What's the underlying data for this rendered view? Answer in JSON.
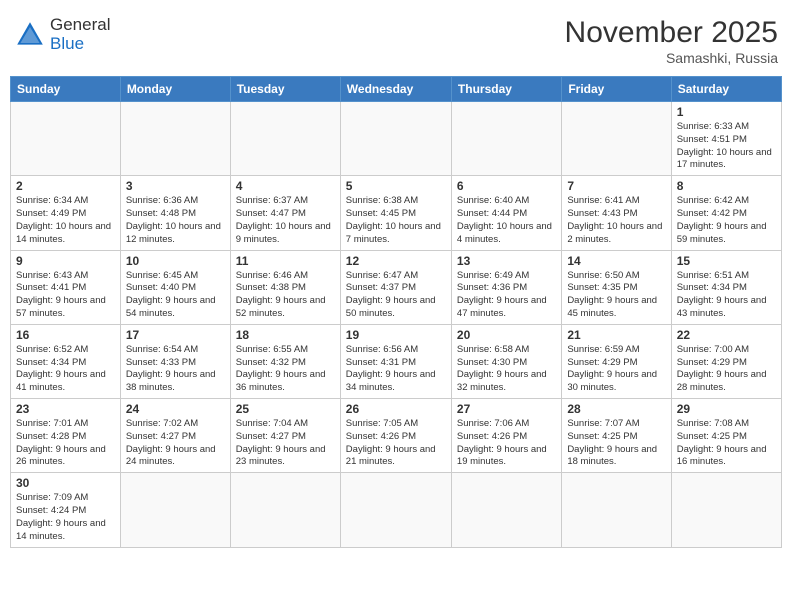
{
  "header": {
    "logo_general": "General",
    "logo_blue": "Blue",
    "month_year": "November 2025",
    "location": "Samashki, Russia"
  },
  "weekdays": [
    "Sunday",
    "Monday",
    "Tuesday",
    "Wednesday",
    "Thursday",
    "Friday",
    "Saturday"
  ],
  "weeks": [
    [
      {
        "day": "",
        "info": ""
      },
      {
        "day": "",
        "info": ""
      },
      {
        "day": "",
        "info": ""
      },
      {
        "day": "",
        "info": ""
      },
      {
        "day": "",
        "info": ""
      },
      {
        "day": "",
        "info": ""
      },
      {
        "day": "1",
        "info": "Sunrise: 6:33 AM\nSunset: 4:51 PM\nDaylight: 10 hours and 17 minutes."
      }
    ],
    [
      {
        "day": "2",
        "info": "Sunrise: 6:34 AM\nSunset: 4:49 PM\nDaylight: 10 hours and 14 minutes."
      },
      {
        "day": "3",
        "info": "Sunrise: 6:36 AM\nSunset: 4:48 PM\nDaylight: 10 hours and 12 minutes."
      },
      {
        "day": "4",
        "info": "Sunrise: 6:37 AM\nSunset: 4:47 PM\nDaylight: 10 hours and 9 minutes."
      },
      {
        "day": "5",
        "info": "Sunrise: 6:38 AM\nSunset: 4:45 PM\nDaylight: 10 hours and 7 minutes."
      },
      {
        "day": "6",
        "info": "Sunrise: 6:40 AM\nSunset: 4:44 PM\nDaylight: 10 hours and 4 minutes."
      },
      {
        "day": "7",
        "info": "Sunrise: 6:41 AM\nSunset: 4:43 PM\nDaylight: 10 hours and 2 minutes."
      },
      {
        "day": "8",
        "info": "Sunrise: 6:42 AM\nSunset: 4:42 PM\nDaylight: 9 hours and 59 minutes."
      }
    ],
    [
      {
        "day": "9",
        "info": "Sunrise: 6:43 AM\nSunset: 4:41 PM\nDaylight: 9 hours and 57 minutes."
      },
      {
        "day": "10",
        "info": "Sunrise: 6:45 AM\nSunset: 4:40 PM\nDaylight: 9 hours and 54 minutes."
      },
      {
        "day": "11",
        "info": "Sunrise: 6:46 AM\nSunset: 4:38 PM\nDaylight: 9 hours and 52 minutes."
      },
      {
        "day": "12",
        "info": "Sunrise: 6:47 AM\nSunset: 4:37 PM\nDaylight: 9 hours and 50 minutes."
      },
      {
        "day": "13",
        "info": "Sunrise: 6:49 AM\nSunset: 4:36 PM\nDaylight: 9 hours and 47 minutes."
      },
      {
        "day": "14",
        "info": "Sunrise: 6:50 AM\nSunset: 4:35 PM\nDaylight: 9 hours and 45 minutes."
      },
      {
        "day": "15",
        "info": "Sunrise: 6:51 AM\nSunset: 4:34 PM\nDaylight: 9 hours and 43 minutes."
      }
    ],
    [
      {
        "day": "16",
        "info": "Sunrise: 6:52 AM\nSunset: 4:34 PM\nDaylight: 9 hours and 41 minutes."
      },
      {
        "day": "17",
        "info": "Sunrise: 6:54 AM\nSunset: 4:33 PM\nDaylight: 9 hours and 38 minutes."
      },
      {
        "day": "18",
        "info": "Sunrise: 6:55 AM\nSunset: 4:32 PM\nDaylight: 9 hours and 36 minutes."
      },
      {
        "day": "19",
        "info": "Sunrise: 6:56 AM\nSunset: 4:31 PM\nDaylight: 9 hours and 34 minutes."
      },
      {
        "day": "20",
        "info": "Sunrise: 6:58 AM\nSunset: 4:30 PM\nDaylight: 9 hours and 32 minutes."
      },
      {
        "day": "21",
        "info": "Sunrise: 6:59 AM\nSunset: 4:29 PM\nDaylight: 9 hours and 30 minutes."
      },
      {
        "day": "22",
        "info": "Sunrise: 7:00 AM\nSunset: 4:29 PM\nDaylight: 9 hours and 28 minutes."
      }
    ],
    [
      {
        "day": "23",
        "info": "Sunrise: 7:01 AM\nSunset: 4:28 PM\nDaylight: 9 hours and 26 minutes."
      },
      {
        "day": "24",
        "info": "Sunrise: 7:02 AM\nSunset: 4:27 PM\nDaylight: 9 hours and 24 minutes."
      },
      {
        "day": "25",
        "info": "Sunrise: 7:04 AM\nSunset: 4:27 PM\nDaylight: 9 hours and 23 minutes."
      },
      {
        "day": "26",
        "info": "Sunrise: 7:05 AM\nSunset: 4:26 PM\nDaylight: 9 hours and 21 minutes."
      },
      {
        "day": "27",
        "info": "Sunrise: 7:06 AM\nSunset: 4:26 PM\nDaylight: 9 hours and 19 minutes."
      },
      {
        "day": "28",
        "info": "Sunrise: 7:07 AM\nSunset: 4:25 PM\nDaylight: 9 hours and 18 minutes."
      },
      {
        "day": "29",
        "info": "Sunrise: 7:08 AM\nSunset: 4:25 PM\nDaylight: 9 hours and 16 minutes."
      }
    ],
    [
      {
        "day": "30",
        "info": "Sunrise: 7:09 AM\nSunset: 4:24 PM\nDaylight: 9 hours and 14 minutes."
      },
      {
        "day": "",
        "info": ""
      },
      {
        "day": "",
        "info": ""
      },
      {
        "day": "",
        "info": ""
      },
      {
        "day": "",
        "info": ""
      },
      {
        "day": "",
        "info": ""
      },
      {
        "day": "",
        "info": ""
      }
    ]
  ]
}
